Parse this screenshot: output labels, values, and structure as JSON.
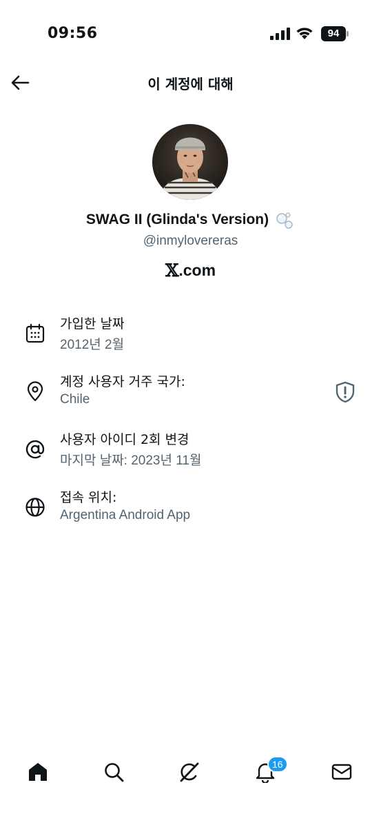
{
  "status_bar": {
    "time": "09:56",
    "battery_level": "94",
    "icons": [
      "signal-icon",
      "wifi-icon",
      "battery-icon"
    ]
  },
  "header": {
    "title": "이 계정에 대해",
    "back_icon": "arrow-left-icon"
  },
  "profile": {
    "display_name": "SWAG II (Glinda's Version)",
    "handle": "@inmylovereras",
    "site_x": "𝕏",
    "site_rest": ".com"
  },
  "info": [
    {
      "icon": "calendar-icon",
      "title": "가입한 날짜",
      "value": "2012년 2월"
    },
    {
      "icon": "location-pin-icon",
      "title": "계정 사용자 거주 국가:",
      "value": "Chile",
      "action_icon": "shield-icon"
    },
    {
      "icon": "at-sign-icon",
      "title": "사용자 아이디 2회 변경",
      "value": "마지막 날짜: 2023년 11월"
    },
    {
      "icon": "globe-icon",
      "title": "접속 위치:",
      "value": "Argentina Android App"
    }
  ],
  "bottom_nav": {
    "items": [
      "home-icon",
      "search-icon",
      "grok-icon",
      "notifications-icon",
      "messages-icon"
    ],
    "notification_count": "16"
  },
  "colors": {
    "text_primary": "#0f1419",
    "text_secondary": "#536471",
    "accent": "#1d9bf0",
    "background": "#ffffff"
  }
}
